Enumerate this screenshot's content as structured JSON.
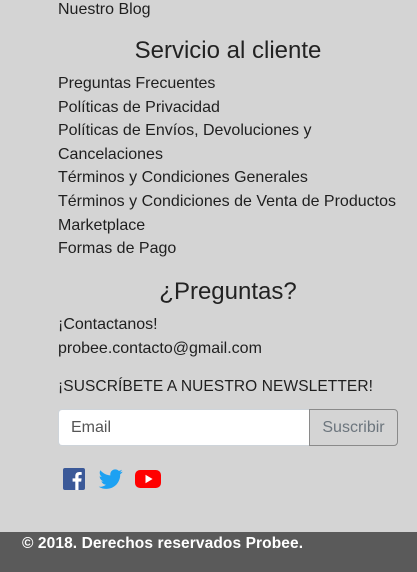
{
  "blog_link": "Nuestro Blog",
  "service": {
    "title": "Servicio al cliente",
    "links": [
      "Preguntas Frecuentes",
      "Políticas de Privacidad",
      "Políticas de Envíos, Devoluciones y Cancelaciones",
      "Términos y Condiciones Generales",
      "Términos y Condiciones de Venta de Productos",
      "Marketplace",
      "Formas de Pago"
    ]
  },
  "questions": {
    "title": "¿Preguntas?",
    "contact_text": "¡Contactanos!",
    "email": "probee.contacto@gmail.com"
  },
  "newsletter": {
    "label": "¡SUSCRÍBETE A NUESTRO NEWSLETTER!",
    "email_placeholder": "Email",
    "subscribe_label": "Suscribir"
  },
  "social": {
    "icons": [
      "facebook-icon",
      "twitter-icon",
      "youtube-icon"
    ],
    "colors": {
      "facebook": "#3b5998",
      "twitter": "#1da1f2",
      "youtube": "#ff0000"
    }
  },
  "footer": {
    "copyright": "© 2018. Derechos reservados Probee."
  },
  "colors": {
    "background": "#d4d4d4",
    "footer_background": "#5a5a5a"
  }
}
